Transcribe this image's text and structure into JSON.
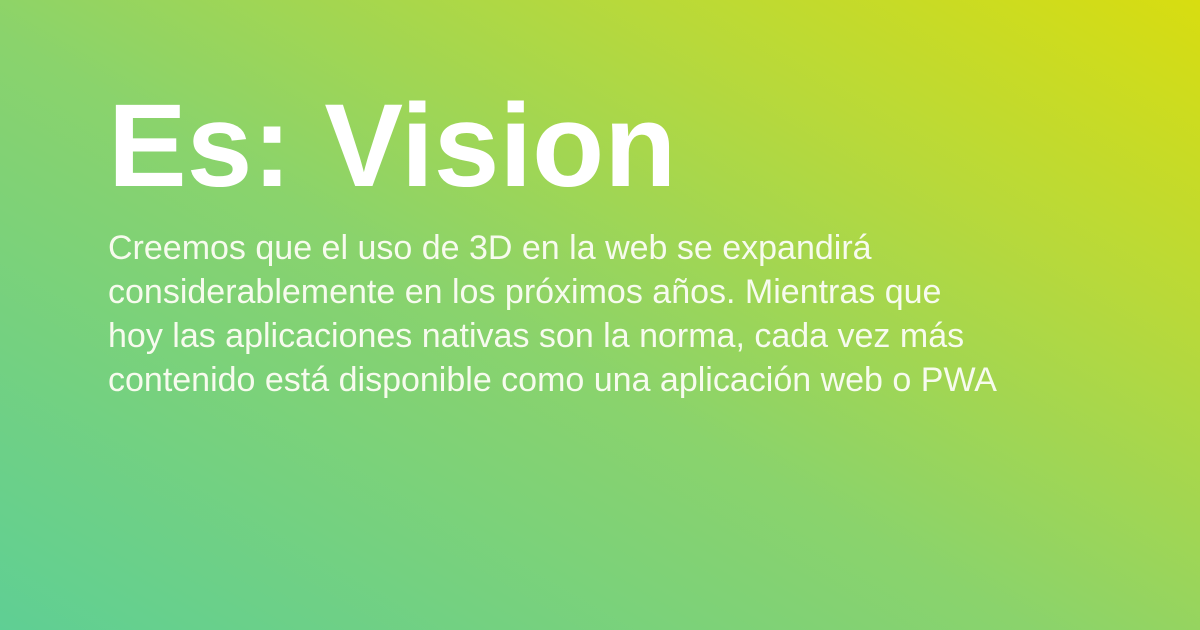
{
  "card": {
    "background_colors": [
      "#5fcf94",
      "#8ad36c",
      "#b8d93a",
      "#d8dd10"
    ],
    "text_color": "#ffffff",
    "title": "Es: Vision",
    "description_lines": [
      "Creemos que el uso de 3D en la web se expandirá",
      "considerablemente en los próximos años. Mientras que",
      "hoy las aplicaciones nativas son la norma, cada vez más",
      "contenido está disponible como una aplicación web o PWA"
    ]
  }
}
